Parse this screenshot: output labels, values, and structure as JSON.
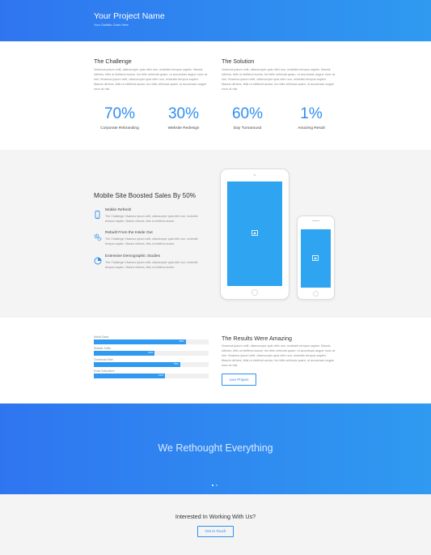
{
  "header": {
    "title": "Your Project Name",
    "subtitle": "Your Subtitle Goes Here"
  },
  "challenge": {
    "title": "The Challenge",
    "text": "Vivamus ipsum velit, ullamcorper quis nibh non, molestie tempus sapien. Mauris ultrices, felis ut eleifend auctor, leo felis vehicula quam, ut accumsan augue nunc at nisl. Vivamus ipsum velit, ullamcorper quis nibh non, molestie tempus sapien. Mauris ultrices, felis ut eleifend auctor, leo felis vehicula quam, ut accumsan augue nunc at nisl."
  },
  "solution": {
    "title": "The Solution",
    "text": "Vivamus ipsum velit, ullamcorper quis nibh non, molestie tempus sapien. Mauris ultrices, felis ut eleifend auctor, leo felis vehicula quam, ut accumsan augue nunc at nisl. Vivamus ipsum velit, ullamcorper quis nibh non, molestie tempus sapien. Mauris ultrices, felis ut eleifend auctor, leo felis vehicula quam, ut accumsan augue nunc at nisl."
  },
  "stats": [
    {
      "value": "70%",
      "label": "Corporate Rebranding"
    },
    {
      "value": "30%",
      "label": "Website Redesign"
    },
    {
      "value": "60%",
      "label": "Day Turnaround"
    },
    {
      "value": "1%",
      "label": "Amazing Result"
    }
  ],
  "mobile": {
    "title": "Mobile Site Boosted Sales By 50%",
    "features": [
      {
        "icon": "mobile-icon",
        "title": "Mobile Refresh",
        "text": "The Challenge Vivamus ipsum velit, ullamcorper quis nibh non, molestie tempus sapien. Mauris ultrices, felis ut eleifend auctor."
      },
      {
        "icon": "gears-icon",
        "title": "Rebuilt From the Inside Out",
        "text": "The Challenge Vivamus ipsum velit, ullamcorper quis nibh non, molestie tempus sapien. Mauris ultrices, felis ut eleifend auctor."
      },
      {
        "icon": "pie-chart-icon",
        "title": "Extensive Demographic Studies",
        "text": "The Challenge Vivamus ipsum velit, ullamcorper quis nibh non, molestie tempus sapien. Mauris ultrices, felis ut eleifend auctor."
      }
    ]
  },
  "results": {
    "bars": [
      {
        "label": "Mobile Sales",
        "value": 80,
        "text": "80%"
      },
      {
        "label": "Website Traffic",
        "value": 53,
        "text": "53%"
      },
      {
        "label": "Conversion Rate",
        "value": 75,
        "text": "75%"
      },
      {
        "label": "Email Subscribers",
        "value": 62,
        "text": "62%"
      }
    ],
    "title": "The Results Were Amazing",
    "text": "Vivamus ipsum velit, ullamcorper quis nibh non, molestie tempus sapien. Mauris ultrices, felis ut eleifend auctor, leo felis vehicula quam, ut accumsan augue nunc at nisl. Vivamus ipsum velit, ullamcorper quis nibh non, molestie tempus sapien. Mauris ultrices, felis ut eleifend auctor, leo felis vehicula quam, ut accumsan augue nunc at nisl.",
    "button": "Live Project"
  },
  "banner": {
    "title": "We Rethought Everything",
    "dots": 2,
    "active_dot": 0
  },
  "cta": {
    "title": "Interested In Working With Us?",
    "button": "Get In Touch"
  },
  "colors": {
    "accent": "#2f8ef0",
    "gradient_start": "#2f75f0",
    "gradient_end": "#2f9af0",
    "device_screen": "#2fa4f0"
  }
}
